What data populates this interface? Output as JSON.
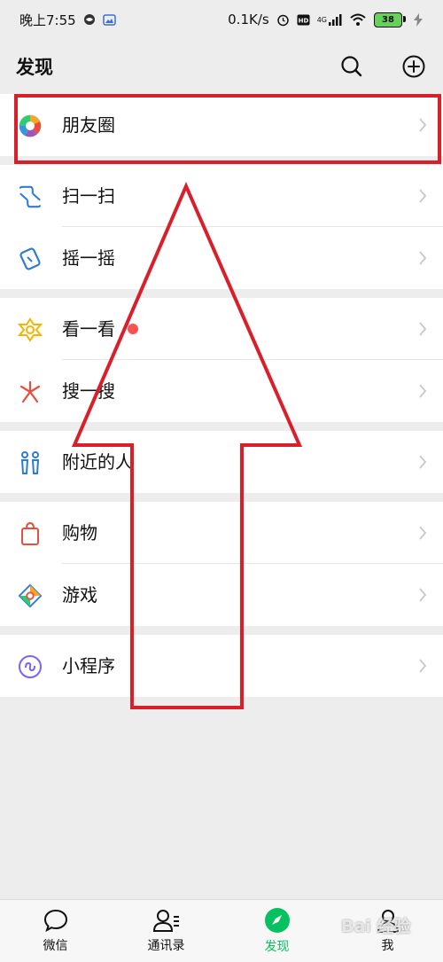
{
  "status_bar": {
    "time": "晚上7:55",
    "speed": "0.1K/s",
    "network": "4G",
    "battery": "38"
  },
  "header": {
    "title": "发现",
    "search_icon": "search-icon",
    "add_icon": "plus-circle-icon"
  },
  "menu": [
    {
      "label": "朋友圈",
      "icon": "moments-icon"
    },
    {
      "label": "扫一扫",
      "icon": "scan-icon"
    },
    {
      "label": "摇一摇",
      "icon": "shake-icon"
    },
    {
      "label": "看一看",
      "icon": "top-stories-icon",
      "badge": "red-dot"
    },
    {
      "label": "搜一搜",
      "icon": "search-spark-icon"
    },
    {
      "label": "附近的人",
      "icon": "people-nearby-icon"
    },
    {
      "label": "购物",
      "icon": "shopping-bag-icon"
    },
    {
      "label": "游戏",
      "icon": "game-icon"
    },
    {
      "label": "小程序",
      "icon": "mini-program-icon"
    }
  ],
  "tabs": [
    {
      "label": "微信",
      "icon": "chat-bubble-icon"
    },
    {
      "label": "通讯录",
      "icon": "contacts-icon"
    },
    {
      "label": "发现",
      "icon": "compass-icon",
      "active": true
    },
    {
      "label": "我",
      "icon": "person-icon"
    }
  ],
  "watermark": "Bai 经验",
  "colors": {
    "accent_green": "#07c160",
    "annotation_red": "#d81f2a",
    "background": "#ededed"
  }
}
